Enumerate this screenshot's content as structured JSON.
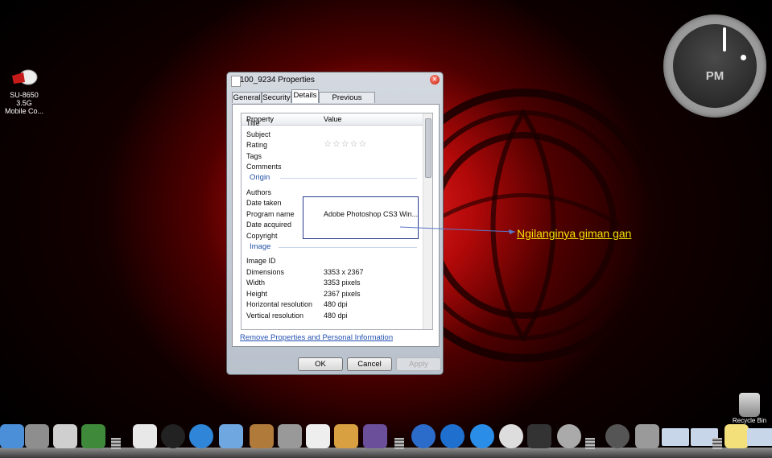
{
  "desktop": {
    "icon_label_line1": "SU-8650 3.5G",
    "icon_label_line2": "Mobile Co...",
    "clock_label": "PM",
    "recycle_bin_label": "Recycle Bin"
  },
  "annotation": {
    "text": "Ngilanginya giman gan"
  },
  "dialog": {
    "title": "100_9234 Properties",
    "tabs": [
      "General",
      "Security",
      "Details",
      "Previous Versions"
    ],
    "active_tab": "Details",
    "columns": {
      "property": "Property",
      "value": "Value"
    },
    "rows_description": [
      {
        "property": "Title",
        "value": ""
      },
      {
        "property": "Subject",
        "value": ""
      },
      {
        "property": "Rating",
        "value": "☆☆☆☆☆"
      },
      {
        "property": "Tags",
        "value": ""
      },
      {
        "property": "Comments",
        "value": ""
      }
    ],
    "group_origin": "Origin",
    "rows_origin": [
      {
        "property": "Authors",
        "value": ""
      },
      {
        "property": "Date taken",
        "value": ""
      },
      {
        "property": "Program name",
        "value": "Adobe Photoshop CS3 Win..."
      },
      {
        "property": "Date acquired",
        "value": ""
      },
      {
        "property": "Copyright",
        "value": ""
      }
    ],
    "group_image": "Image",
    "rows_image": [
      {
        "property": "Image ID",
        "value": ""
      },
      {
        "property": "Dimensions",
        "value": "3353 x 2367"
      },
      {
        "property": "Width",
        "value": "3353 pixels"
      },
      {
        "property": "Height",
        "value": "2367 pixels"
      },
      {
        "property": "Horizontal resolution",
        "value": "480 dpi"
      },
      {
        "property": "Vertical resolution",
        "value": "480 dpi"
      }
    ],
    "remove_link": "Remove Properties and Personal Information",
    "buttons": {
      "ok": "OK",
      "cancel": "Cancel",
      "apply": "Apply"
    }
  },
  "dock": {
    "items": [
      "finder-icon",
      "system-preferences-icon",
      "printer-icon",
      "photo-viewer-icon",
      "home-icon",
      "dashboard-icon",
      "safari-icon",
      "mail-icon",
      "address-book-icon",
      "calculator-icon",
      "textedit-icon",
      "directory-utility-icon",
      "front-row-icon",
      "itunes-icon",
      "quicktime-icon",
      "app-store-icon",
      "user-photo-icon",
      "imovie-icon",
      "rocket-icon",
      "power-icon",
      "trash-icon",
      "window-thumbnail-icon",
      "window-thumbnail-icon",
      "notes-icon",
      "window-thumbnail-icon"
    ],
    "colors": {
      "finder": "#4a8fd8",
      "sysprefs": "#8e8e8e",
      "printer": "#cfcfcf",
      "photo": "#3f8a3a",
      "home": "#e8e8e8",
      "dashboard": "#222222",
      "safari": "#2f86d8",
      "mail": "#6fa7e0",
      "addressbook": "#b07a3b",
      "calculator": "#999999",
      "textedit": "#eeeeee",
      "directory": "#d8a040",
      "frontrow": "#6b4f9a",
      "itunes": "#2b6bc9",
      "quicktime": "#1f6fcf",
      "appstore": "#2a8de8",
      "user": "#dddddd",
      "imovie": "#333333",
      "rocket": "#aaaaaa",
      "power": "#555555",
      "trash": "#9a9a9a",
      "thumb": "#c8d6ea",
      "notes": "#f3e07a"
    }
  }
}
